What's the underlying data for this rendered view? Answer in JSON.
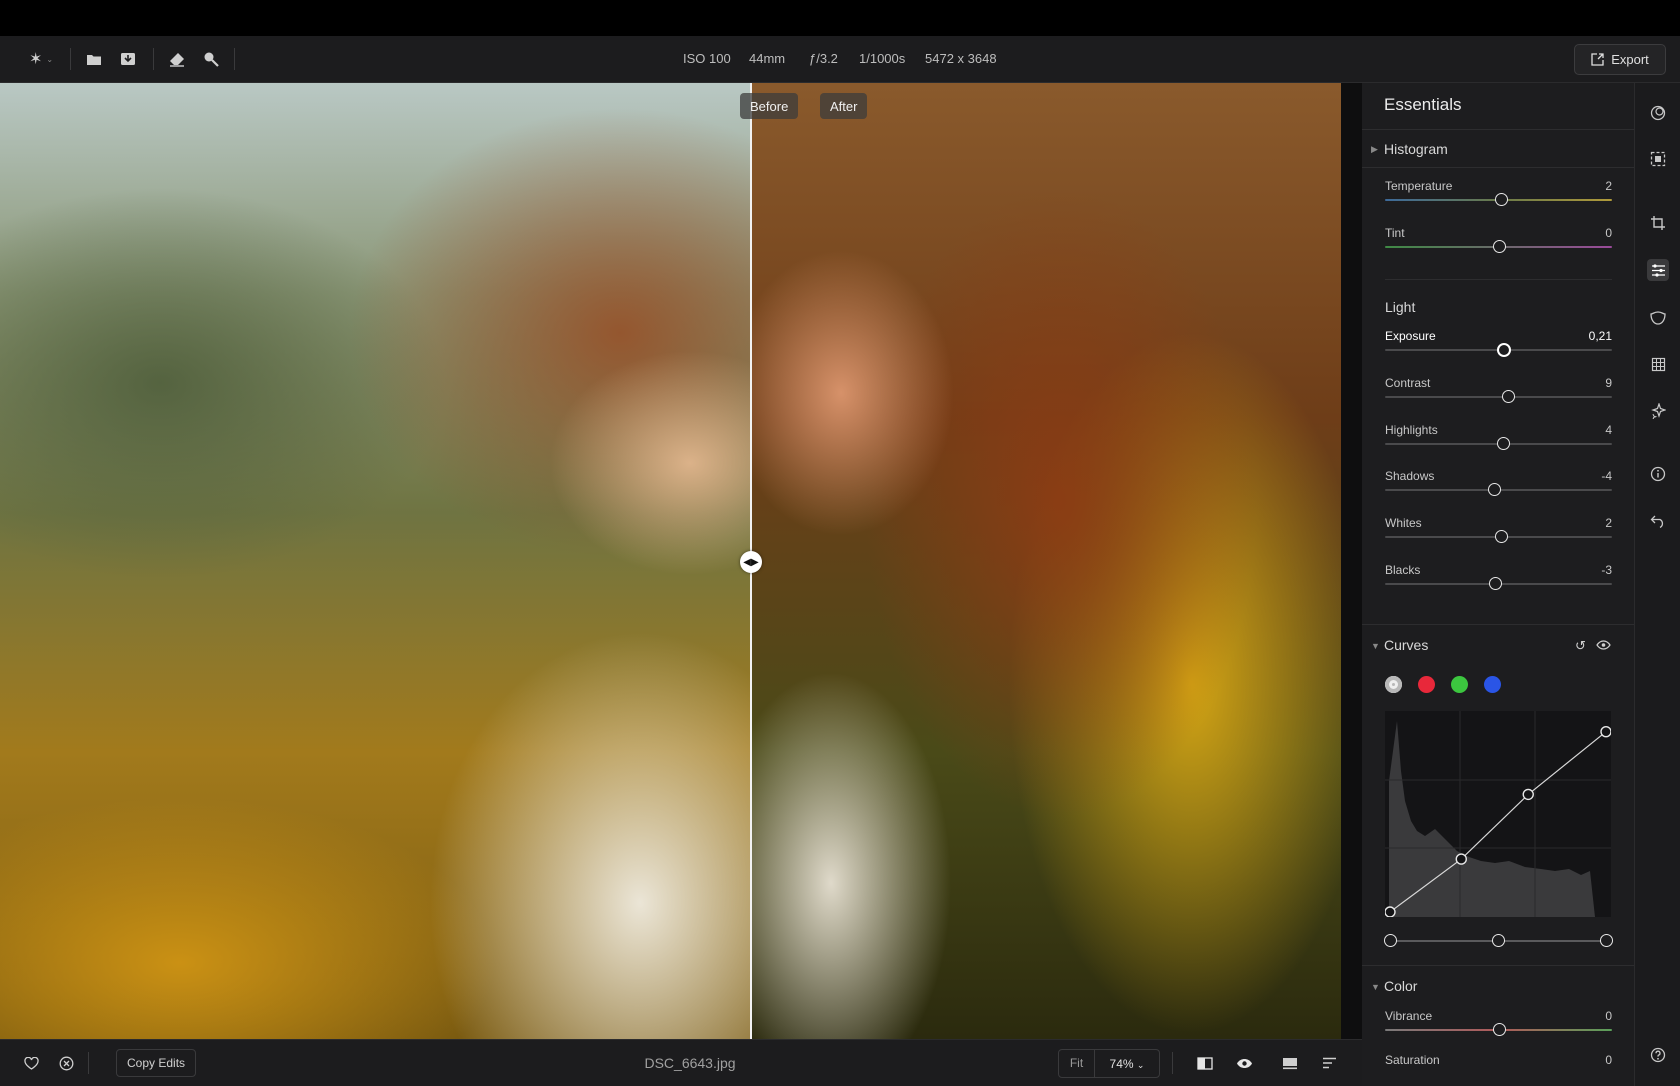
{
  "toolbar": {
    "exif": {
      "iso": "ISO 100",
      "focal": "44mm",
      "aperture": "ƒ/3.2",
      "shutter": "1/1000s",
      "resolution": "5472 x 3648"
    },
    "export_label": "Export",
    "icons": [
      "sparkle-icon",
      "folder-icon",
      "import-icon",
      "eraser-icon",
      "magic-icon"
    ]
  },
  "viewer": {
    "before_label": "Before",
    "after_label": "After",
    "split_percent": 56
  },
  "bottombar": {
    "copy_edits_label": "Copy Edits",
    "filename": "DSC_6643.jpg",
    "zoom_fit": "Fit",
    "zoom_value": "74%"
  },
  "panel": {
    "title": "Essentials",
    "histogram_label": "Histogram",
    "white_balance": [
      {
        "label": "Temperature",
        "value": "2",
        "level": 0.51
      },
      {
        "label": "Tint",
        "value": "0",
        "level": 0.5
      }
    ],
    "light_label": "Light",
    "light": [
      {
        "label": "Exposure",
        "value": "0,21",
        "level": 0.52
      },
      {
        "label": "Contrast",
        "value": "9",
        "level": 0.54
      },
      {
        "label": "Highlights",
        "value": "4",
        "level": 0.52
      },
      {
        "label": "Shadows",
        "value": "-4",
        "level": 0.48
      },
      {
        "label": "Whites",
        "value": "2",
        "level": 0.51
      },
      {
        "label": "Blacks",
        "value": "-3",
        "level": 0.485
      }
    ],
    "curves_label": "Curves",
    "curve_channels": [
      {
        "name": "luminance",
        "color": "#b8b8b8"
      },
      {
        "name": "red",
        "color": "#e8283a"
      },
      {
        "name": "green",
        "color": "#3cc63f"
      },
      {
        "name": "blue",
        "color": "#2a55e6"
      }
    ],
    "curve_points": [
      [
        0,
        0
      ],
      [
        0.33,
        0.27
      ],
      [
        0.64,
        0.6
      ],
      [
        1,
        0.92
      ]
    ],
    "color_label": "Color",
    "color": [
      {
        "label": "Vibrance",
        "value": "0",
        "level": 0.5
      },
      {
        "label": "Saturation",
        "value": "0",
        "level": 0.5
      }
    ]
  }
}
